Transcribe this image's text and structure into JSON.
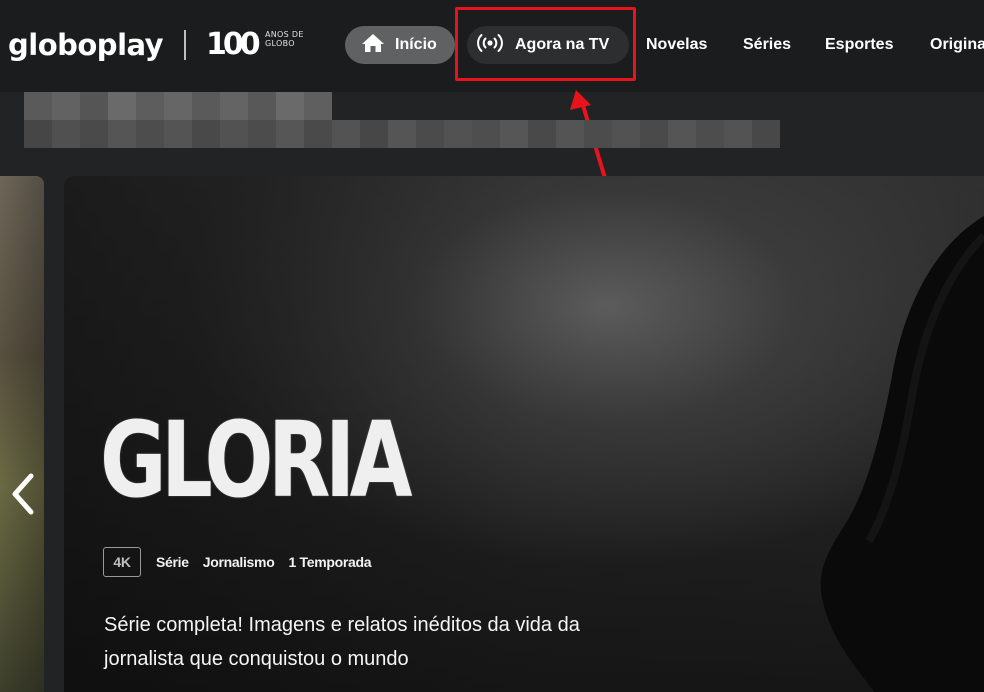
{
  "header": {
    "logo_text": "globoplay",
    "badge_number": "100",
    "badge_subtitle": "ANOS DE GLOBO",
    "nav": [
      {
        "label": "Início",
        "icon": "home-icon",
        "active": true
      },
      {
        "label": "Agora na TV",
        "icon": "live-broadcast-icon",
        "highlighted": true
      },
      {
        "label": "Novelas"
      },
      {
        "label": "Séries"
      },
      {
        "label": "Esportes"
      },
      {
        "label": "Origina"
      }
    ]
  },
  "annotation": {
    "color": "#e8141b"
  },
  "hero": {
    "title": "GLORIA",
    "quality_badge": "4K",
    "meta": [
      "Série",
      "Jornalismo",
      "1 Temporada"
    ],
    "description": "Série completa! Imagens e relatos inéditos da vida da jornalista que conquistou o mundo"
  },
  "colors": {
    "background": "#222325",
    "active_pill": "#606163",
    "annotation": "#e8141b"
  }
}
